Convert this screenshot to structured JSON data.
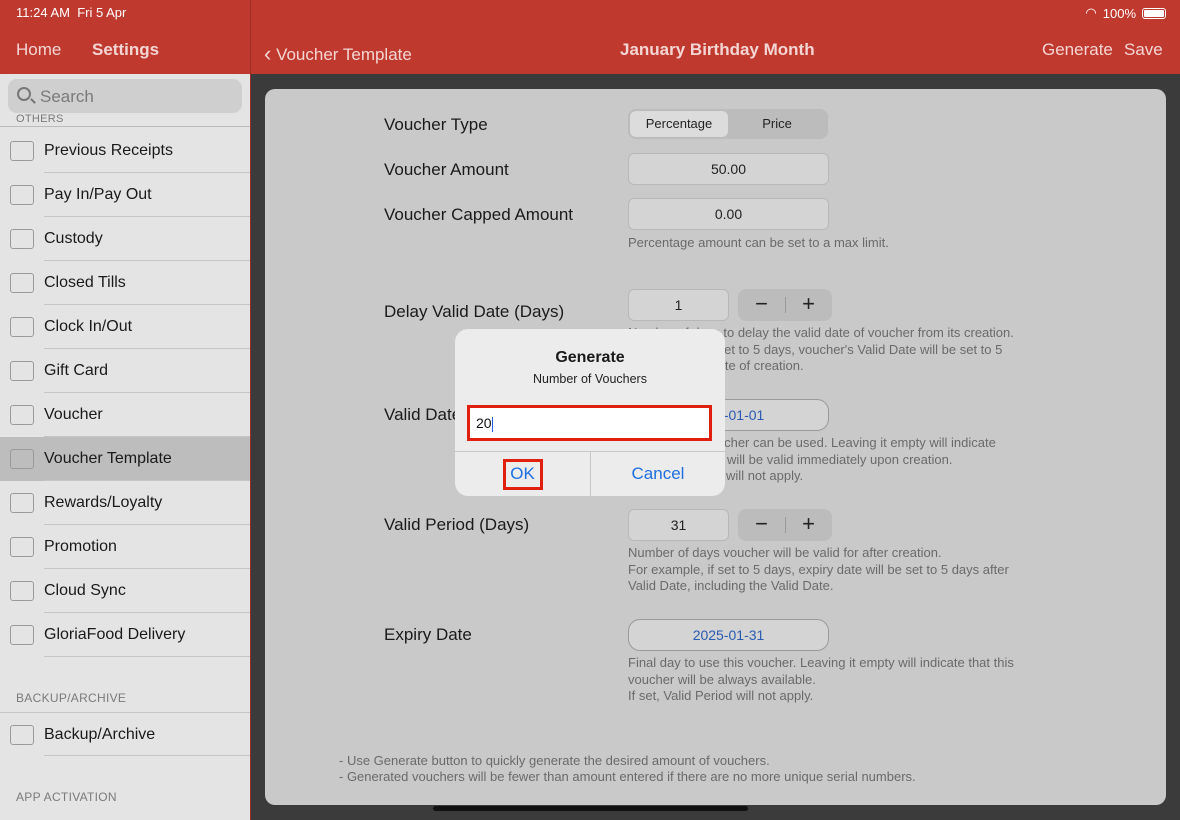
{
  "status": {
    "time": "11:24 AM",
    "date": "Fri 5 Apr",
    "battery": "100%"
  },
  "sidebar_nav": {
    "home": "Home",
    "settings": "Settings"
  },
  "header": {
    "back": "Voucher Template",
    "title": "January Birthday Month",
    "generate": "Generate",
    "save": "Save"
  },
  "sidebar": {
    "search_placeholder": "Search",
    "section_others": "OTHERS",
    "items": [
      {
        "label": "Previous Receipts",
        "icon": "receipt-icon"
      },
      {
        "label": "Pay In/Pay Out",
        "icon": "hand-coin-icon"
      },
      {
        "label": "Custody",
        "icon": "receipt-icon"
      },
      {
        "label": "Closed Tills",
        "icon": "cash-register-icon"
      },
      {
        "label": "Clock In/Out",
        "icon": "clock-icon"
      },
      {
        "label": "Gift Card",
        "icon": "gift-card-icon"
      },
      {
        "label": "Voucher",
        "icon": "voucher-icon"
      },
      {
        "label": "Voucher Template",
        "icon": "voucher-icon",
        "selected": true
      },
      {
        "label": "Rewards/Loyalty",
        "icon": "trophy-icon"
      },
      {
        "label": "Promotion",
        "icon": "megaphone-icon"
      },
      {
        "label": "Cloud Sync",
        "icon": "cloud-sync-icon"
      },
      {
        "label": "GloriaFood Delivery",
        "icon": "leaf-icon"
      }
    ],
    "section_backup": "BACKUP/ARCHIVE",
    "backup_item": "Backup/Archive",
    "section_activation": "APP ACTIVATION"
  },
  "form": {
    "voucher_type": {
      "label": "Voucher Type",
      "options": [
        "Percentage",
        "Price"
      ],
      "selected": "Percentage"
    },
    "voucher_amount": {
      "label": "Voucher Amount",
      "value": "50.00"
    },
    "capped_amount": {
      "label": "Voucher Capped Amount",
      "value": "0.00",
      "help": "Percentage amount can be set to a max limit."
    },
    "delay": {
      "label": "Delay Valid Date (Days)",
      "value": "1",
      "help1": "Number of days to delay the valid date of voucher from its creation.",
      "help2": "For example, if set to 5 days, voucher's Valid Date will be set to 5",
      "help3": "days after the date of creation."
    },
    "valid_date": {
      "label": "Valid Date",
      "value": "2025-01-01",
      "help1": "First day the voucher can be used. Leaving it empty will indicate",
      "help2": "that this voucher will be valid immediately upon creation.",
      "help3": "If set, Valid Date will not apply."
    },
    "valid_period": {
      "label": "Valid Period (Days)",
      "value": "31",
      "help1": "Number of days voucher will be valid for after creation.",
      "help2": "For example, if set to 5 days, expiry date will be set to 5 days after",
      "help3": "Valid Date, including the Valid Date."
    },
    "expiry": {
      "label": "Expiry Date",
      "value": "2025-01-31",
      "help1": "Final day to use this voucher. Leaving it empty will indicate that this",
      "help2": "voucher will be always available.",
      "help3": "If set, Valid Period will not apply."
    },
    "footer1": "- Use Generate button to quickly generate the desired amount of vouchers.",
    "footer2": "- Generated vouchers will be fewer than amount entered if there are no more unique serial numbers."
  },
  "dialog": {
    "title": "Generate",
    "message": "Number of Vouchers",
    "input_value": "20",
    "ok": "OK",
    "cancel": "Cancel"
  },
  "colors": {
    "header": "#c0392f",
    "highlight": "#e0200f",
    "link": "#1e6fe0"
  }
}
